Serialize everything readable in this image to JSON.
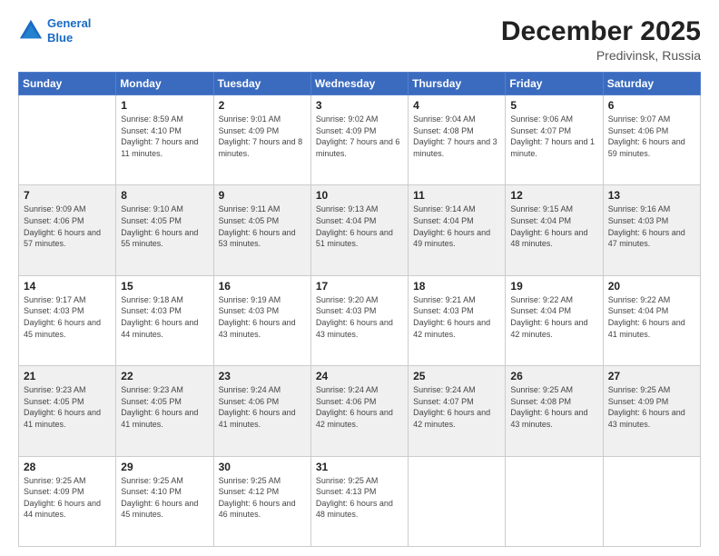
{
  "header": {
    "logo_line1": "General",
    "logo_line2": "Blue",
    "month": "December 2025",
    "location": "Predivinsk, Russia"
  },
  "days_of_week": [
    "Sunday",
    "Monday",
    "Tuesday",
    "Wednesday",
    "Thursday",
    "Friday",
    "Saturday"
  ],
  "weeks": [
    [
      {
        "day": "",
        "sunrise": "",
        "sunset": "",
        "daylight": ""
      },
      {
        "day": "1",
        "sunrise": "Sunrise: 8:59 AM",
        "sunset": "Sunset: 4:10 PM",
        "daylight": "Daylight: 7 hours and 11 minutes."
      },
      {
        "day": "2",
        "sunrise": "Sunrise: 9:01 AM",
        "sunset": "Sunset: 4:09 PM",
        "daylight": "Daylight: 7 hours and 8 minutes."
      },
      {
        "day": "3",
        "sunrise": "Sunrise: 9:02 AM",
        "sunset": "Sunset: 4:09 PM",
        "daylight": "Daylight: 7 hours and 6 minutes."
      },
      {
        "day": "4",
        "sunrise": "Sunrise: 9:04 AM",
        "sunset": "Sunset: 4:08 PM",
        "daylight": "Daylight: 7 hours and 3 minutes."
      },
      {
        "day": "5",
        "sunrise": "Sunrise: 9:06 AM",
        "sunset": "Sunset: 4:07 PM",
        "daylight": "Daylight: 7 hours and 1 minute."
      },
      {
        "day": "6",
        "sunrise": "Sunrise: 9:07 AM",
        "sunset": "Sunset: 4:06 PM",
        "daylight": "Daylight: 6 hours and 59 minutes."
      }
    ],
    [
      {
        "day": "7",
        "sunrise": "Sunrise: 9:09 AM",
        "sunset": "Sunset: 4:06 PM",
        "daylight": "Daylight: 6 hours and 57 minutes."
      },
      {
        "day": "8",
        "sunrise": "Sunrise: 9:10 AM",
        "sunset": "Sunset: 4:05 PM",
        "daylight": "Daylight: 6 hours and 55 minutes."
      },
      {
        "day": "9",
        "sunrise": "Sunrise: 9:11 AM",
        "sunset": "Sunset: 4:05 PM",
        "daylight": "Daylight: 6 hours and 53 minutes."
      },
      {
        "day": "10",
        "sunrise": "Sunrise: 9:13 AM",
        "sunset": "Sunset: 4:04 PM",
        "daylight": "Daylight: 6 hours and 51 minutes."
      },
      {
        "day": "11",
        "sunrise": "Sunrise: 9:14 AM",
        "sunset": "Sunset: 4:04 PM",
        "daylight": "Daylight: 6 hours and 49 minutes."
      },
      {
        "day": "12",
        "sunrise": "Sunrise: 9:15 AM",
        "sunset": "Sunset: 4:04 PM",
        "daylight": "Daylight: 6 hours and 48 minutes."
      },
      {
        "day": "13",
        "sunrise": "Sunrise: 9:16 AM",
        "sunset": "Sunset: 4:03 PM",
        "daylight": "Daylight: 6 hours and 47 minutes."
      }
    ],
    [
      {
        "day": "14",
        "sunrise": "Sunrise: 9:17 AM",
        "sunset": "Sunset: 4:03 PM",
        "daylight": "Daylight: 6 hours and 45 minutes."
      },
      {
        "day": "15",
        "sunrise": "Sunrise: 9:18 AM",
        "sunset": "Sunset: 4:03 PM",
        "daylight": "Daylight: 6 hours and 44 minutes."
      },
      {
        "day": "16",
        "sunrise": "Sunrise: 9:19 AM",
        "sunset": "Sunset: 4:03 PM",
        "daylight": "Daylight: 6 hours and 43 minutes."
      },
      {
        "day": "17",
        "sunrise": "Sunrise: 9:20 AM",
        "sunset": "Sunset: 4:03 PM",
        "daylight": "Daylight: 6 hours and 43 minutes."
      },
      {
        "day": "18",
        "sunrise": "Sunrise: 9:21 AM",
        "sunset": "Sunset: 4:03 PM",
        "daylight": "Daylight: 6 hours and 42 minutes."
      },
      {
        "day": "19",
        "sunrise": "Sunrise: 9:22 AM",
        "sunset": "Sunset: 4:04 PM",
        "daylight": "Daylight: 6 hours and 42 minutes."
      },
      {
        "day": "20",
        "sunrise": "Sunrise: 9:22 AM",
        "sunset": "Sunset: 4:04 PM",
        "daylight": "Daylight: 6 hours and 41 minutes."
      }
    ],
    [
      {
        "day": "21",
        "sunrise": "Sunrise: 9:23 AM",
        "sunset": "Sunset: 4:05 PM",
        "daylight": "Daylight: 6 hours and 41 minutes."
      },
      {
        "day": "22",
        "sunrise": "Sunrise: 9:23 AM",
        "sunset": "Sunset: 4:05 PM",
        "daylight": "Daylight: 6 hours and 41 minutes."
      },
      {
        "day": "23",
        "sunrise": "Sunrise: 9:24 AM",
        "sunset": "Sunset: 4:06 PM",
        "daylight": "Daylight: 6 hours and 41 minutes."
      },
      {
        "day": "24",
        "sunrise": "Sunrise: 9:24 AM",
        "sunset": "Sunset: 4:06 PM",
        "daylight": "Daylight: 6 hours and 42 minutes."
      },
      {
        "day": "25",
        "sunrise": "Sunrise: 9:24 AM",
        "sunset": "Sunset: 4:07 PM",
        "daylight": "Daylight: 6 hours and 42 minutes."
      },
      {
        "day": "26",
        "sunrise": "Sunrise: 9:25 AM",
        "sunset": "Sunset: 4:08 PM",
        "daylight": "Daylight: 6 hours and 43 minutes."
      },
      {
        "day": "27",
        "sunrise": "Sunrise: 9:25 AM",
        "sunset": "Sunset: 4:09 PM",
        "daylight": "Daylight: 6 hours and 43 minutes."
      }
    ],
    [
      {
        "day": "28",
        "sunrise": "Sunrise: 9:25 AM",
        "sunset": "Sunset: 4:09 PM",
        "daylight": "Daylight: 6 hours and 44 minutes."
      },
      {
        "day": "29",
        "sunrise": "Sunrise: 9:25 AM",
        "sunset": "Sunset: 4:10 PM",
        "daylight": "Daylight: 6 hours and 45 minutes."
      },
      {
        "day": "30",
        "sunrise": "Sunrise: 9:25 AM",
        "sunset": "Sunset: 4:12 PM",
        "daylight": "Daylight: 6 hours and 46 minutes."
      },
      {
        "day": "31",
        "sunrise": "Sunrise: 9:25 AM",
        "sunset": "Sunset: 4:13 PM",
        "daylight": "Daylight: 6 hours and 48 minutes."
      },
      {
        "day": "",
        "sunrise": "",
        "sunset": "",
        "daylight": ""
      },
      {
        "day": "",
        "sunrise": "",
        "sunset": "",
        "daylight": ""
      },
      {
        "day": "",
        "sunrise": "",
        "sunset": "",
        "daylight": ""
      }
    ]
  ]
}
